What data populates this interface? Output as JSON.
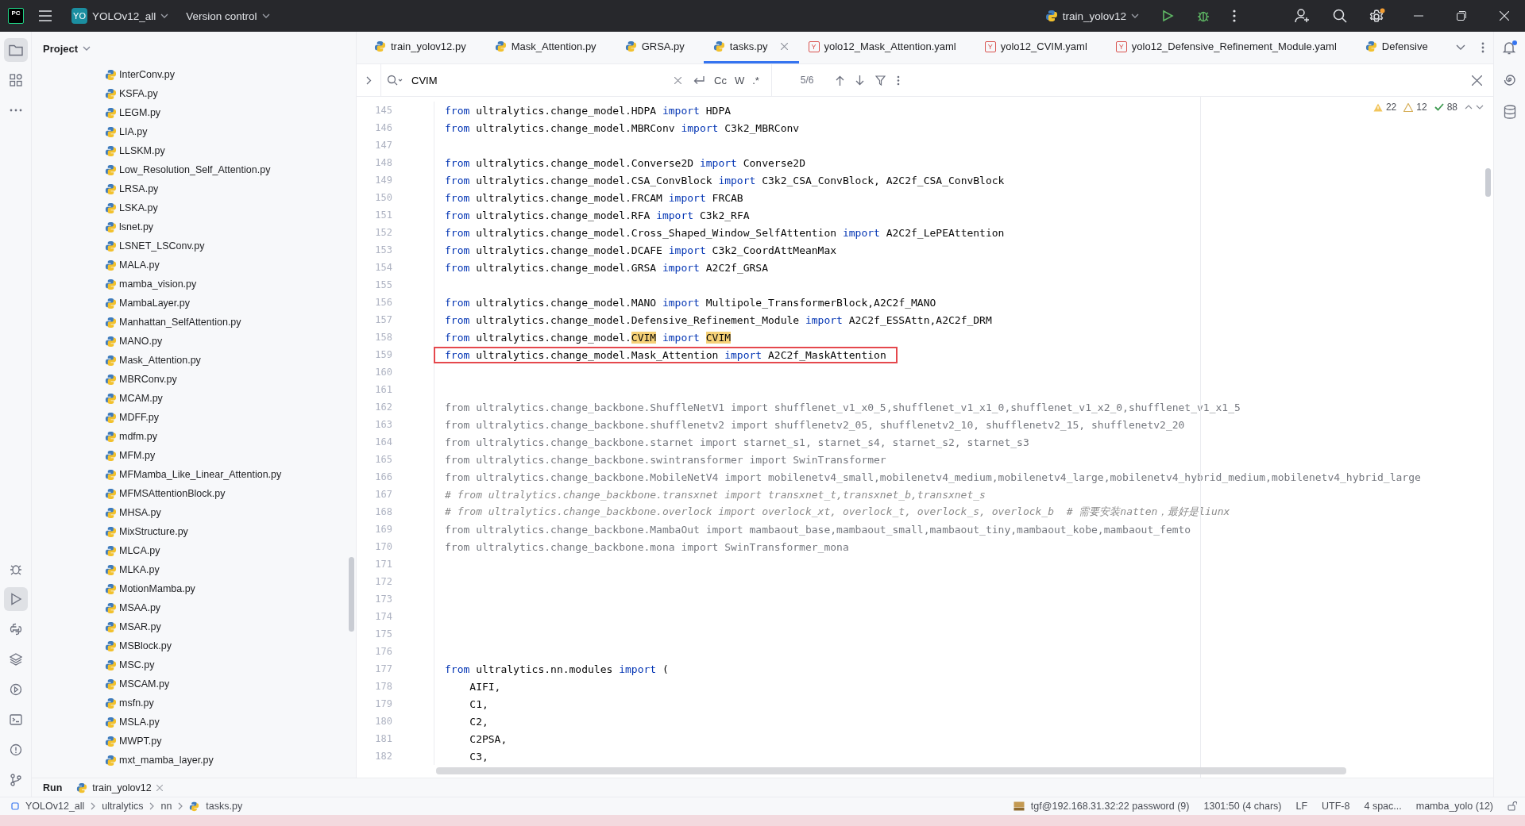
{
  "titlebar": {
    "logo": "PC",
    "project_badge": "YO",
    "project": "YOLOv12_all",
    "vcs": "Version control",
    "run_config": "train_yolov12"
  },
  "tool_buttons": [
    {
      "kind": "project",
      "selected": true
    },
    {
      "kind": "structure",
      "selected": false
    },
    {
      "kind": "more",
      "selected": false
    },
    {
      "kind": "debug",
      "selected": false
    },
    {
      "kind": "run",
      "selected": true
    },
    {
      "kind": "console",
      "selected": false
    },
    {
      "kind": "layers",
      "selected": false
    },
    {
      "kind": "services",
      "selected": false
    },
    {
      "kind": "terminal",
      "selected": false
    },
    {
      "kind": "problems",
      "selected": false
    },
    {
      "kind": "git",
      "selected": false
    }
  ],
  "project": {
    "header": "Project",
    "items": [
      "InterConv.py",
      "KSFA.py",
      "LEGM.py",
      "LIA.py",
      "LLSKM.py",
      "Low_Resolution_Self_Attention.py",
      "LRSA.py",
      "LSKA.py",
      "lsnet.py",
      "LSNET_LSConv.py",
      "MALA.py",
      "mamba_vision.py",
      "MambaLayer.py",
      "Manhattan_SelfAttention.py",
      "MANO.py",
      "Mask_Attention.py",
      "MBRConv.py",
      "MCAM.py",
      "MDFF.py",
      "mdfm.py",
      "MFM.py",
      "MFMamba_Like_Linear_Attention.py",
      "MFMSAttentionBlock.py",
      "MHSA.py",
      "MixStructure.py",
      "MLCA.py",
      "MLKA.py",
      "MotionMamba.py",
      "MSAA.py",
      "MSAR.py",
      "MSBlock.py",
      "MSC.py",
      "MSCAM.py",
      "msfn.py",
      "MSLA.py",
      "MWPT.py",
      "mxt_mamba_layer.py"
    ]
  },
  "tabs": [
    {
      "label": "train_yolov12.py",
      "kind": "py",
      "selected": false
    },
    {
      "label": "Mask_Attention.py",
      "kind": "py",
      "selected": false
    },
    {
      "label": "GRSA.py",
      "kind": "py",
      "selected": false
    },
    {
      "label": "tasks.py",
      "kind": "py",
      "selected": true
    },
    {
      "label": "yolo12_Mask_Attention.yaml",
      "kind": "yaml",
      "badge": "Y",
      "selected": false
    },
    {
      "label": "yolo12_CVIM.yaml",
      "kind": "yaml",
      "badge": "Y",
      "selected": false
    },
    {
      "label": "yolo12_Defensive_Refinement_Module.yaml",
      "kind": "yaml",
      "badge": "Y",
      "selected": false
    },
    {
      "label": "Defensive",
      "kind": "py",
      "selected": false
    }
  ],
  "search": {
    "value": "CVIM",
    "match_case": "Cc",
    "words": "W",
    "regex": ".*",
    "count": "5/6"
  },
  "inspections": {
    "warnings": "22",
    "weak_warnings": "12",
    "ok": "88"
  },
  "code": [
    {
      "number": "145",
      "kind": "code",
      "segments": [
        {
          "kind": "kw",
          "text": "from"
        },
        {
          "kind": "plain",
          "text": " ultralytics.change_model.HDPA "
        },
        {
          "kind": "kw",
          "text": "import"
        },
        {
          "kind": "plain",
          "text": " HDPA"
        }
      ]
    },
    {
      "number": "146",
      "kind": "code",
      "segments": [
        {
          "kind": "kw",
          "text": "from"
        },
        {
          "kind": "plain",
          "text": " ultralytics.change_model.MBRConv "
        },
        {
          "kind": "kw",
          "text": "import"
        },
        {
          "kind": "plain",
          "text": " C3k2_MBRConv"
        }
      ]
    },
    {
      "number": "147",
      "kind": "empty"
    },
    {
      "number": "148",
      "kind": "code",
      "segments": [
        {
          "kind": "kw",
          "text": "from"
        },
        {
          "kind": "plain",
          "text": " ultralytics.change_model.Converse2D "
        },
        {
          "kind": "kw",
          "text": "import"
        },
        {
          "kind": "plain",
          "text": " Converse2D"
        }
      ]
    },
    {
      "number": "149",
      "kind": "code",
      "segments": [
        {
          "kind": "kw",
          "text": "from"
        },
        {
          "kind": "plain",
          "text": " ultralytics.change_model.CSA_ConvBlock "
        },
        {
          "kind": "kw",
          "text": "import"
        },
        {
          "kind": "plain",
          "text": " C3k2_CSA_ConvBlock, A2C2f_CSA_ConvBlock"
        }
      ]
    },
    {
      "number": "150",
      "kind": "code",
      "segments": [
        {
          "kind": "kw",
          "text": "from"
        },
        {
          "kind": "plain",
          "text": " ultralytics.change_model.FRCAM "
        },
        {
          "kind": "kw",
          "text": "import"
        },
        {
          "kind": "plain",
          "text": " FRCAB"
        }
      ]
    },
    {
      "number": "151",
      "kind": "code",
      "segments": [
        {
          "kind": "kw",
          "text": "from"
        },
        {
          "kind": "plain",
          "text": " ultralytics.change_model.RFA "
        },
        {
          "kind": "kw",
          "text": "import"
        },
        {
          "kind": "plain",
          "text": " C3k2_RFA"
        }
      ]
    },
    {
      "number": "152",
      "kind": "code",
      "segments": [
        {
          "kind": "kw",
          "text": "from"
        },
        {
          "kind": "plain",
          "text": " ultralytics.change_model.Cross_Shaped_Window_SelfAttention "
        },
        {
          "kind": "kw",
          "text": "import"
        },
        {
          "kind": "plain",
          "text": " A2C2f_LePEAttention"
        }
      ]
    },
    {
      "number": "153",
      "kind": "code",
      "segments": [
        {
          "kind": "kw",
          "text": "from"
        },
        {
          "kind": "plain",
          "text": " ultralytics.change_model.DCAFE "
        },
        {
          "kind": "kw",
          "text": "import"
        },
        {
          "kind": "plain",
          "text": " C3k2_CoordAttMeanMax"
        }
      ]
    },
    {
      "number": "154",
      "kind": "code",
      "segments": [
        {
          "kind": "kw",
          "text": "from"
        },
        {
          "kind": "plain",
          "text": " ultralytics.change_model.GRSA "
        },
        {
          "kind": "kw",
          "text": "import"
        },
        {
          "kind": "plain",
          "text": " A2C2f_GRSA"
        }
      ]
    },
    {
      "number": "155",
      "kind": "empty"
    },
    {
      "number": "156",
      "kind": "code",
      "segments": [
        {
          "kind": "kw",
          "text": "from"
        },
        {
          "kind": "plain",
          "text": " ultralytics.change_model.MANO "
        },
        {
          "kind": "kw",
          "text": "import"
        },
        {
          "kind": "plain",
          "text": " Multipole_TransformerBlock,A2C2f_MANO"
        }
      ]
    },
    {
      "number": "157",
      "kind": "code",
      "segments": [
        {
          "kind": "kw",
          "text": "from"
        },
        {
          "kind": "plain",
          "text": " ultralytics.change_model.Defensive_Refinement_Module "
        },
        {
          "kind": "kw",
          "text": "import"
        },
        {
          "kind": "plain",
          "text": " A2C2f_ESSAttn,A2C2f_DRM"
        }
      ]
    },
    {
      "number": "158",
      "kind": "code",
      "segments": [
        {
          "kind": "kw",
          "text": "from"
        },
        {
          "kind": "plain",
          "text": " ultralytics.change_model."
        },
        {
          "kind": "match",
          "text": "CVIM"
        },
        {
          "kind": "kw",
          "text": " import "
        },
        {
          "kind": "match",
          "text": "CVIM"
        }
      ]
    },
    {
      "number": "159",
      "kind": "code",
      "boxed": true,
      "segments": [
        {
          "kind": "kw",
          "text": "from"
        },
        {
          "kind": "plain",
          "text": " ultralytics.change_model.Mask_Attention "
        },
        {
          "kind": "kw",
          "text": "import"
        },
        {
          "kind": "plain",
          "text": " A2C2f_MaskAttention"
        }
      ]
    },
    {
      "number": "160",
      "kind": "empty"
    },
    {
      "number": "161",
      "kind": "empty"
    },
    {
      "number": "162",
      "kind": "unused",
      "text": "from ultralytics.change_backbone.ShuffleNetV1 import shufflenet_v1_x0_5,shufflenet_v1_x1_0,shufflenet_v1_x2_0,shufflenet_v1_x1_5"
    },
    {
      "number": "163",
      "kind": "unused",
      "text": "from ultralytics.change_backbone.shufflenetv2 import shufflenetv2_05, shufflenetv2_10, shufflenetv2_15, shufflenetv2_20"
    },
    {
      "number": "164",
      "kind": "unused",
      "text": "from ultralytics.change_backbone.starnet import starnet_s1, starnet_s4, starnet_s2, starnet_s3"
    },
    {
      "number": "165",
      "kind": "unused",
      "text": "from ultralytics.change_backbone.swintransformer import SwinTransformer"
    },
    {
      "number": "166",
      "kind": "unused",
      "text": "from ultralytics.change_backbone.MobileNetV4 import mobilenetv4_small,mobilenetv4_medium,mobilenetv4_large,mobilenetv4_hybrid_medium,mobilenetv4_hybrid_large"
    },
    {
      "number": "167",
      "kind": "comment",
      "text": "# from ultralytics.change_backbone.transxnet import transxnet_t,transxnet_b,transxnet_s"
    },
    {
      "number": "168",
      "kind": "comment",
      "text": "# from ultralytics.change_backbone.overlock import overlock_xt, overlock_t, overlock_s, overlock_b  # 需要安装natten，最好是liunx"
    },
    {
      "number": "169",
      "kind": "unused",
      "text": "from ultralytics.change_backbone.MambaOut import mambaout_base,mambaout_small,mambaout_tiny,mambaout_kobe,mambaout_femto"
    },
    {
      "number": "170",
      "kind": "unused",
      "text": "from ultralytics.change_backbone.mona import SwinTransformer_mona"
    },
    {
      "number": "171",
      "kind": "empty"
    },
    {
      "number": "172",
      "kind": "empty"
    },
    {
      "number": "173",
      "kind": "empty"
    },
    {
      "number": "174",
      "kind": "empty"
    },
    {
      "number": "175",
      "kind": "empty"
    },
    {
      "number": "176",
      "kind": "empty"
    },
    {
      "number": "177",
      "kind": "code",
      "segments": [
        {
          "kind": "kw",
          "text": "from"
        },
        {
          "kind": "plain",
          "text": " ultralytics.nn.modules "
        },
        {
          "kind": "kw",
          "text": "import"
        },
        {
          "kind": "plain",
          "text": " ("
        }
      ]
    },
    {
      "number": "178",
      "kind": "code",
      "segments": [
        {
          "kind": "plain",
          "text": "    AIFI,"
        }
      ]
    },
    {
      "number": "179",
      "kind": "code",
      "segments": [
        {
          "kind": "plain",
          "text": "    C1,"
        }
      ]
    },
    {
      "number": "180",
      "kind": "code",
      "segments": [
        {
          "kind": "plain",
          "text": "    C2,"
        }
      ]
    },
    {
      "number": "181",
      "kind": "code",
      "segments": [
        {
          "kind": "plain",
          "text": "    C2PSA,"
        }
      ]
    },
    {
      "number": "182",
      "kind": "code",
      "segments": [
        {
          "kind": "plain",
          "text": "    C3,"
        }
      ]
    }
  ],
  "run_bar": {
    "label": "Run",
    "tab": "train_yolov12"
  },
  "breadcrumbs": [
    "YOLOv12_all",
    "ultralytics",
    "nn",
    "tasks.py"
  ],
  "status": {
    "remote": "tgf@192.168.31.32:22 password (9)",
    "position": "1301:50 (4 chars)",
    "line_ending": "LF",
    "encoding": "UTF-8",
    "indent": "4 spac...",
    "interpreter": "mamba_yolo (12)"
  }
}
